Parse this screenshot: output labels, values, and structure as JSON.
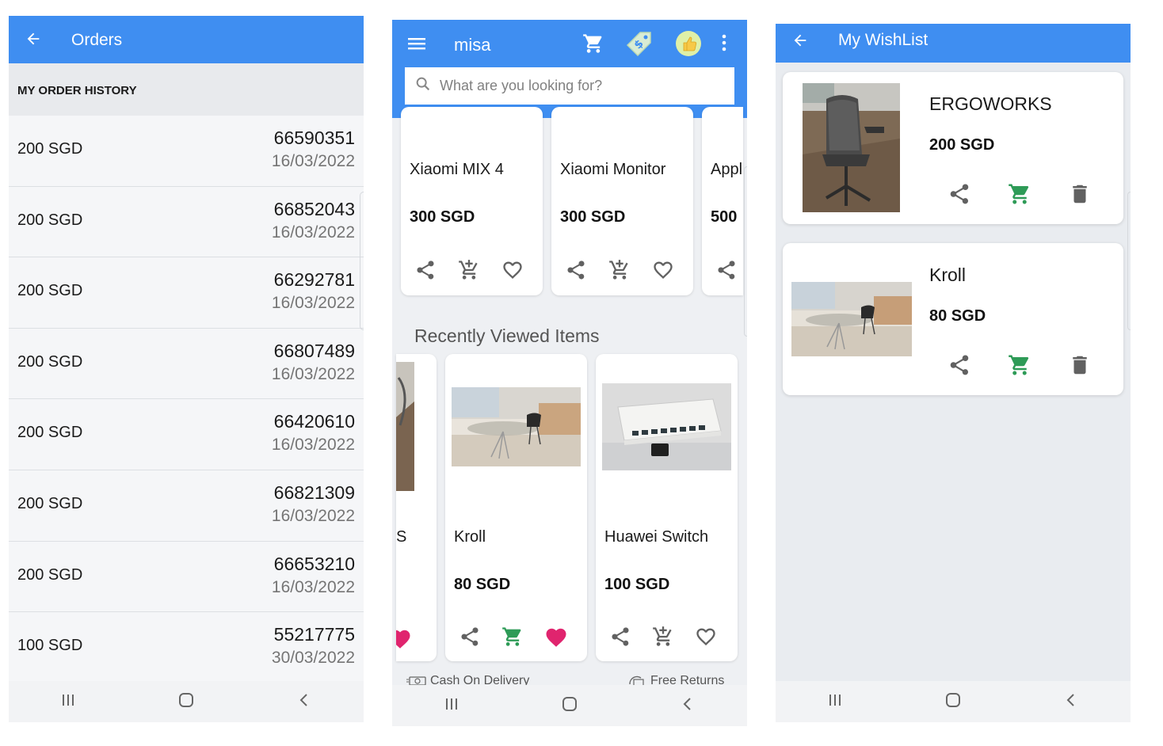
{
  "orders_screen": {
    "title": "Orders",
    "section_header": "MY ORDER HISTORY",
    "orders": [
      {
        "amount": "200 SGD",
        "id": "66590351",
        "date": "16/03/2022"
      },
      {
        "amount": "200 SGD",
        "id": "66852043",
        "date": "16/03/2022"
      },
      {
        "amount": "200 SGD",
        "id": "66292781",
        "date": "16/03/2022"
      },
      {
        "amount": "200 SGD",
        "id": "66807489",
        "date": "16/03/2022"
      },
      {
        "amount": "200 SGD",
        "id": "66420610",
        "date": "16/03/2022"
      },
      {
        "amount": "200 SGD",
        "id": "66821309",
        "date": "16/03/2022"
      },
      {
        "amount": "200 SGD",
        "id": "66653210",
        "date": "16/03/2022"
      },
      {
        "amount": "100 SGD",
        "id": "55217775",
        "date": "30/03/2022"
      }
    ]
  },
  "home_screen": {
    "title": "misa",
    "search_placeholder": "What are you looking for?",
    "products": [
      {
        "name": "Xiaomi MIX 4",
        "price": "300 SGD"
      },
      {
        "name": "Xiaomi Monitor",
        "price": "300 SGD"
      },
      {
        "name": "Appl",
        "price": "500"
      }
    ],
    "recently_viewed_title": "Recently Viewed Items",
    "recent_items": [
      {
        "name": "S",
        "price": ""
      },
      {
        "name": "Kroll",
        "price": "80 SGD"
      },
      {
        "name": "Huawei Switch",
        "price": "100 SGD"
      }
    ],
    "footer": {
      "left": "Cash On Delivery",
      "right": "Free Returns"
    }
  },
  "wishlist_screen": {
    "title": "My WishList",
    "items": [
      {
        "name": "ERGOWORKS",
        "price": "200 SGD"
      },
      {
        "name": "Kroll",
        "price": "80 SGD"
      }
    ]
  },
  "colors": {
    "appbar": "#3f8ef1",
    "cart_green": "#2e9b57",
    "heart_pink": "#e0246e",
    "icon_gray": "#616161"
  },
  "icons": [
    "back-arrow-icon",
    "menu-icon",
    "cart-icon",
    "tag-icon",
    "thumb-icon",
    "more-vert-icon",
    "search-icon",
    "share-icon",
    "add-to-cart-icon",
    "heart-outline-icon",
    "heart-filled-icon",
    "delete-icon",
    "recents-icon",
    "home-icon",
    "nav-back-icon"
  ]
}
